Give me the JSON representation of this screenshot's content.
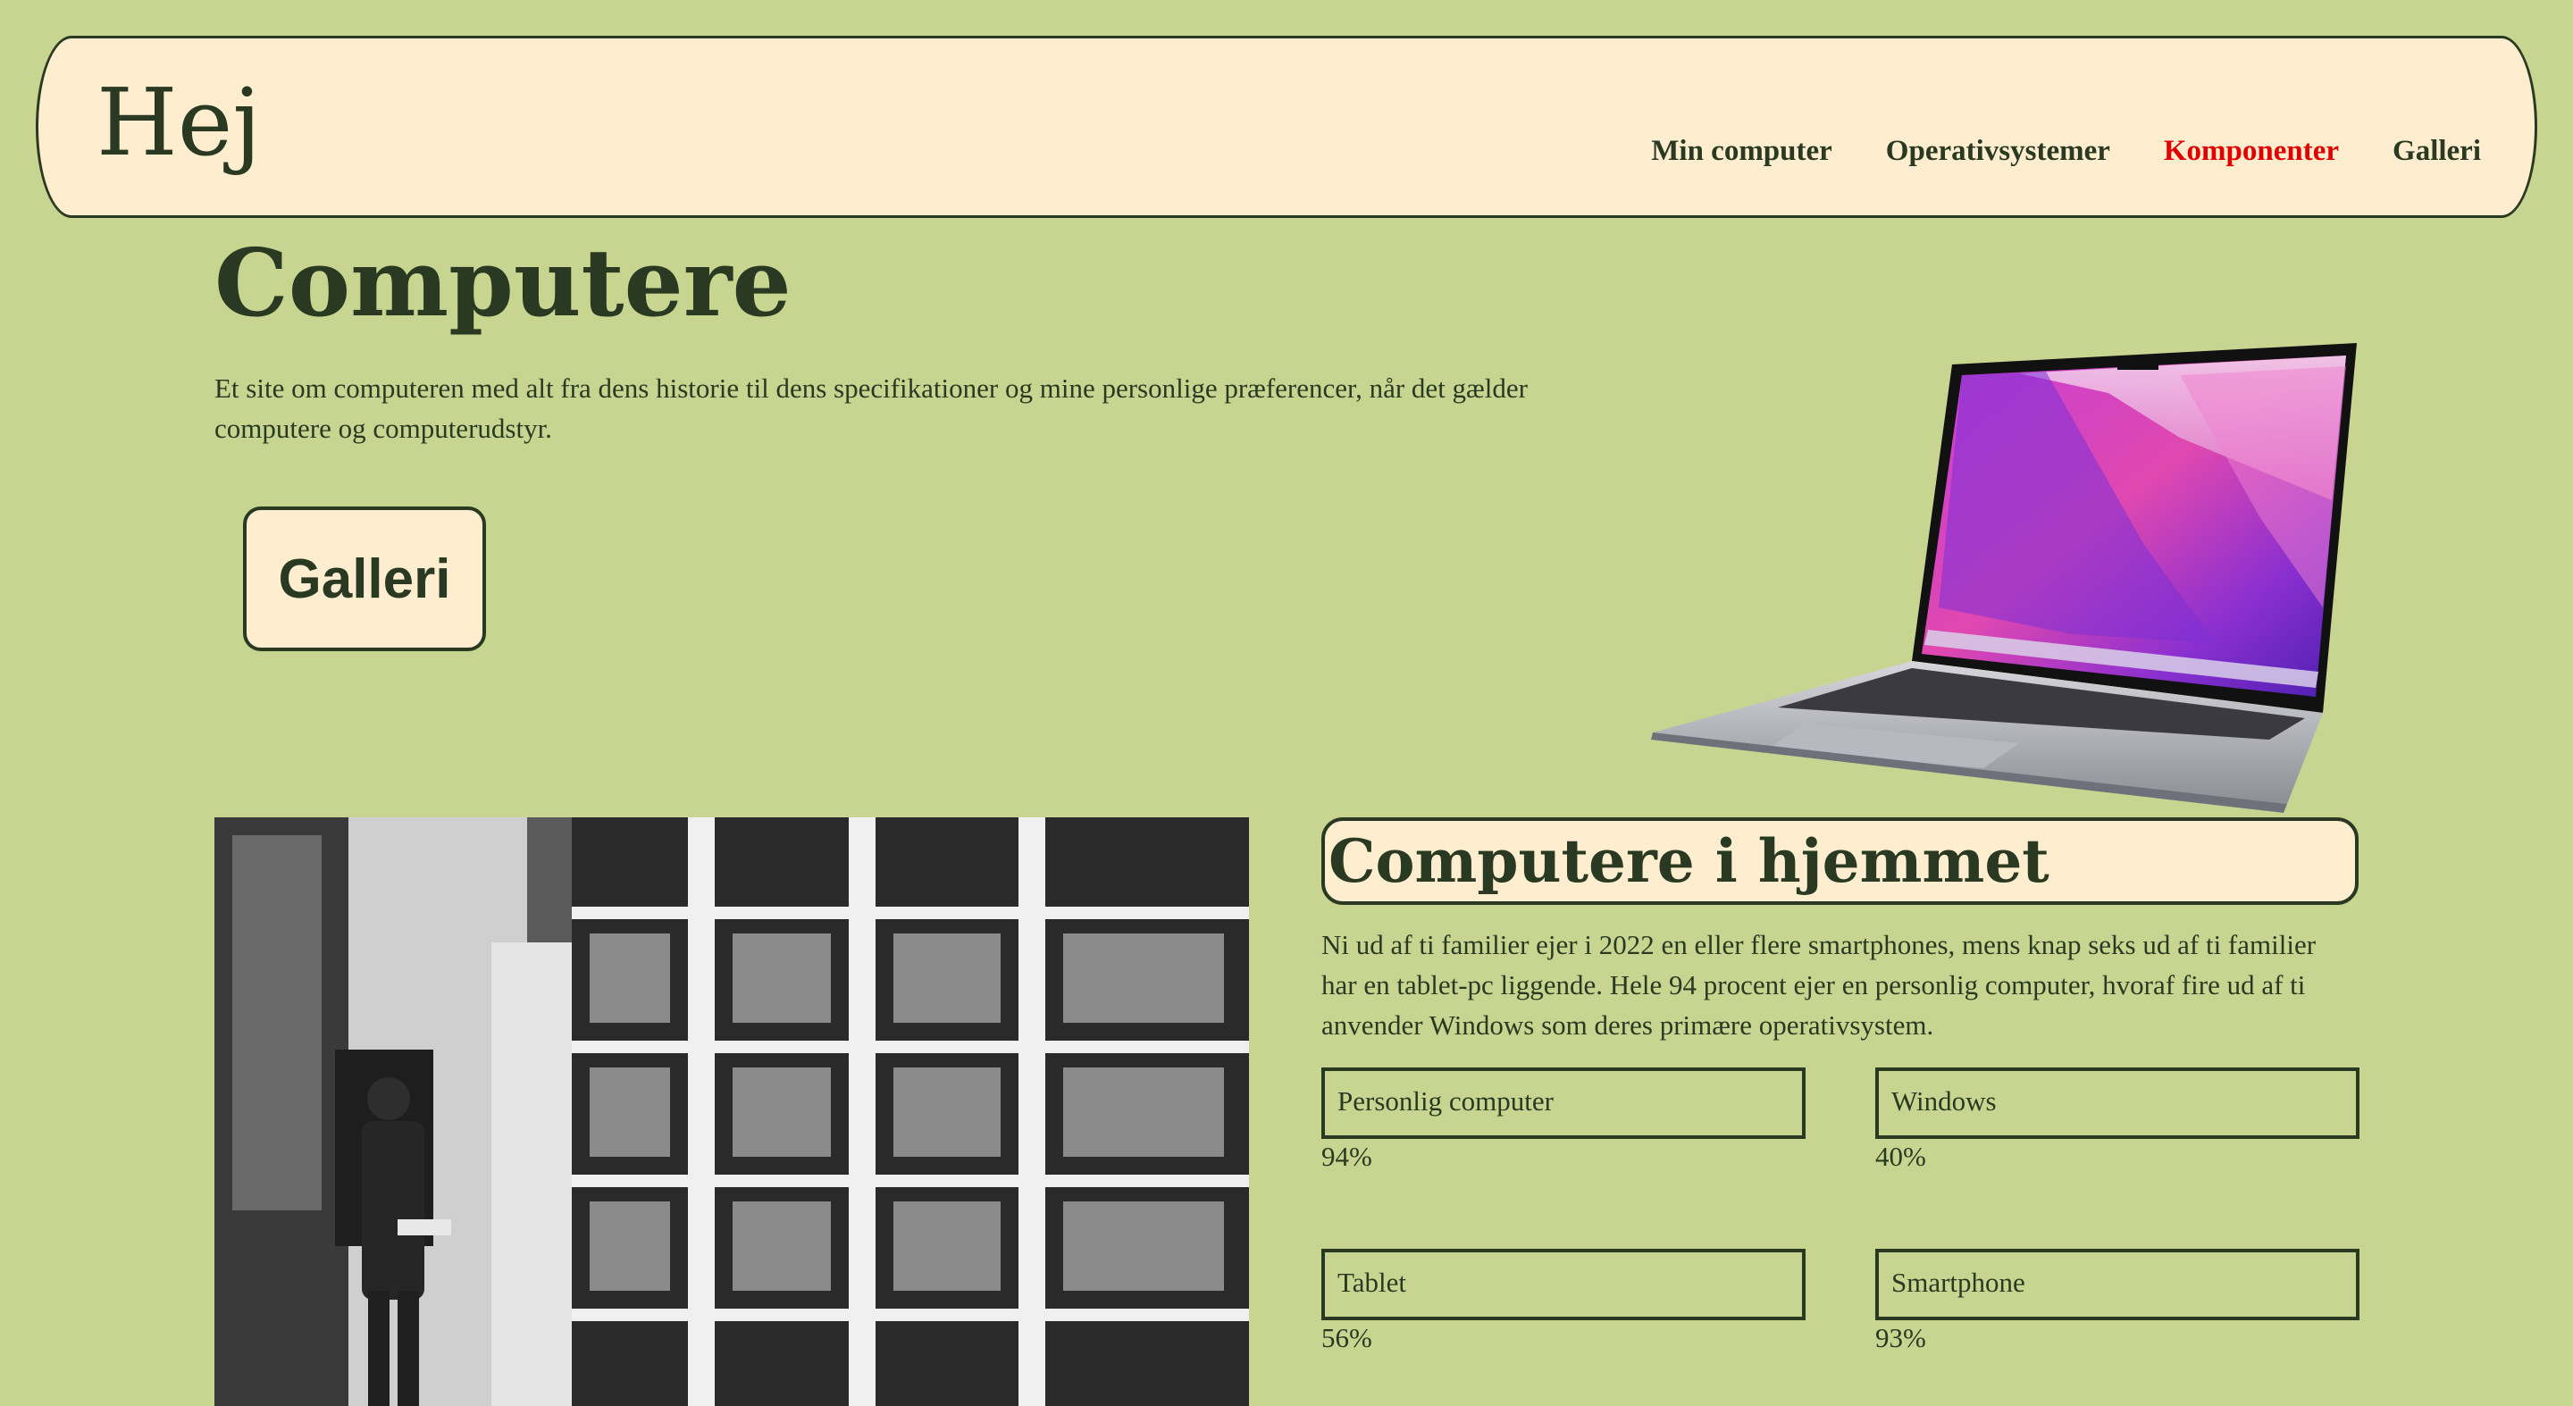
{
  "header": {
    "logo": "Hej",
    "nav": [
      {
        "label": "Min computer"
      },
      {
        "label": "Operativsystemer"
      },
      {
        "label": "Komponenter"
      },
      {
        "label": "Galleri"
      }
    ],
    "active_color": "#e00000"
  },
  "hero": {
    "title": "Computere",
    "text": "Et site om computeren med alt fra dens historie til dens specifikationer og mine personlige præferencer, når det gælder computere og computerudstyr.",
    "button_label": "Galleri"
  },
  "section": {
    "title": "Computere i hjemmet",
    "text": "Ni ud af ti familier ejer i 2022 en eller flere smartphones, mens knap seks ud af ti familier har en tablet-pc liggende. Hele 94 procent ejer en personlig computer, hvoraf fire ud af ti anvender Windows som deres primære operativsystem.",
    "stats": [
      {
        "label": "Personlig computer",
        "value": "94%"
      },
      {
        "label": "Windows",
        "value": "40%"
      },
      {
        "label": "Tablet",
        "value": "56%"
      },
      {
        "label": "Smartphone",
        "value": "93%"
      }
    ]
  },
  "colors": {
    "background": "#c8d590",
    "panel": "#feedcf",
    "text": "#2a3a22",
    "active_link": "#e00000"
  }
}
